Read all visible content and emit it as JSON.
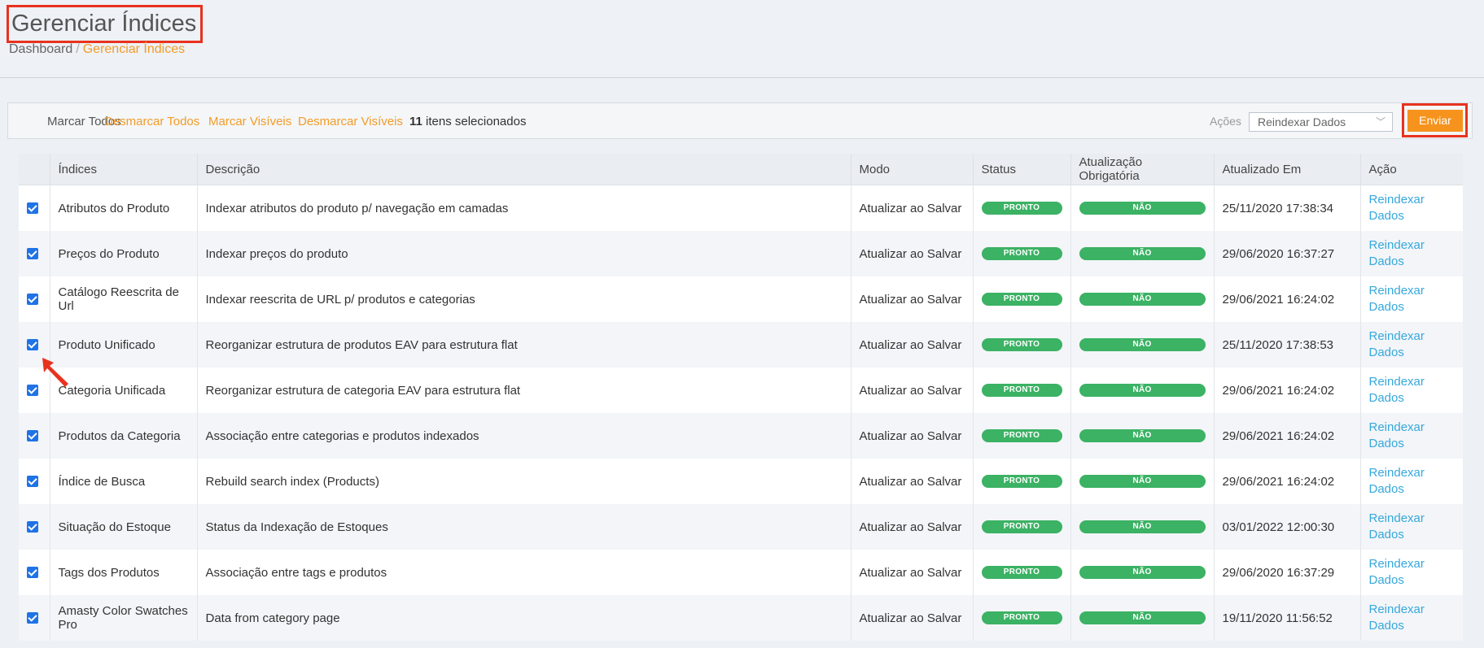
{
  "header": {
    "title": "Gerenciar Índices",
    "breadcrumb": {
      "home": "Dashboard",
      "separator": "/",
      "current": "Gerenciar Índices"
    }
  },
  "massaction": {
    "select_all": "Marcar Todos",
    "unselect_all": "Desmarcar Todos",
    "select_visible": "Marcar Visíveis",
    "unselect_visible": "Desmarcar Visíveis",
    "selected_count": "11",
    "selected_suffix": " itens selecionados",
    "actions_label": "Ações",
    "action_value": "Reindexar Dados",
    "submit_label": "Enviar"
  },
  "columns": [
    "Índices",
    "Descrição",
    "Modo",
    "Status",
    "Atualização Obrigatória",
    "Atualizado Em",
    "Ação"
  ],
  "rows": [
    {
      "index": "Atributos do Produto",
      "description": "Indexar atributos do produto p/ navegação em camadas",
      "mode": "Atualizar ao Salvar",
      "status": "PRONTO",
      "required": "NÃO",
      "updated": "25/11/2020 17:38:34",
      "action": "Reindexar Dados"
    },
    {
      "index": "Preços do Produto",
      "description": "Indexar preços do produto",
      "mode": "Atualizar ao Salvar",
      "status": "PRONTO",
      "required": "NÃO",
      "updated": "29/06/2020 16:37:27",
      "action": "Reindexar Dados"
    },
    {
      "index": "Catálogo Reescrita de Url",
      "description": "Indexar reescrita de URL p/ produtos e categorias",
      "mode": "Atualizar ao Salvar",
      "status": "PRONTO",
      "required": "NÃO",
      "updated": "29/06/2021 16:24:02",
      "action": "Reindexar Dados"
    },
    {
      "index": "Produto Unificado",
      "description": "Reorganizar estrutura de produtos EAV para estrutura flat",
      "mode": "Atualizar ao Salvar",
      "status": "PRONTO",
      "required": "NÃO",
      "updated": "25/11/2020 17:38:53",
      "action": "Reindexar Dados"
    },
    {
      "index": "Categoria Unificada",
      "description": "Reorganizar estrutura de categoria EAV para estrutura flat",
      "mode": "Atualizar ao Salvar",
      "status": "PRONTO",
      "required": "NÃO",
      "updated": "29/06/2021 16:24:02",
      "action": "Reindexar Dados"
    },
    {
      "index": "Produtos da Categoria",
      "description": "Associação entre categorias e produtos indexados",
      "mode": "Atualizar ao Salvar",
      "status": "PRONTO",
      "required": "NÃO",
      "updated": "29/06/2021 16:24:02",
      "action": "Reindexar Dados"
    },
    {
      "index": "Índice de Busca",
      "description": "Rebuild search index (Products)",
      "mode": "Atualizar ao Salvar",
      "status": "PRONTO",
      "required": "NÃO",
      "updated": "29/06/2021 16:24:02",
      "action": "Reindexar Dados"
    },
    {
      "index": "Situação do Estoque",
      "description": "Status da Indexação de Estoques",
      "mode": "Atualizar ao Salvar",
      "status": "PRONTO",
      "required": "NÃO",
      "updated": "03/01/2022 12:00:30",
      "action": "Reindexar Dados"
    },
    {
      "index": "Tags dos Produtos",
      "description": "Associação entre tags e produtos",
      "mode": "Atualizar ao Salvar",
      "status": "PRONTO",
      "required": "NÃO",
      "updated": "29/06/2020 16:37:29",
      "action": "Reindexar Dados"
    },
    {
      "index": "Amasty Color Swatches Pro",
      "description": "Data from category page",
      "mode": "Atualizar ao Salvar",
      "status": "PRONTO",
      "required": "NÃO",
      "updated": "19/11/2020 11:56:52",
      "action": "Reindexar Dados"
    }
  ],
  "colors": {
    "accent_orange": "#f39c27",
    "badge_green": "#3bb264",
    "link_blue": "#36a8dc",
    "highlight_red": "#e8321e"
  }
}
